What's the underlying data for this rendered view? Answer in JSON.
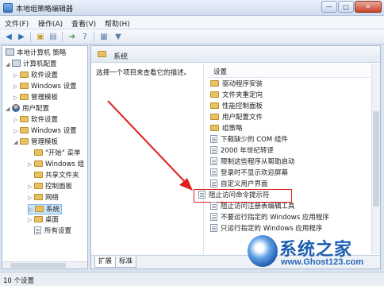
{
  "window": {
    "title": "本地组策略编辑器",
    "min": "—",
    "max": "□",
    "close": "✕"
  },
  "menu": [
    "文件(F)",
    "操作(A)",
    "查看(V)",
    "帮助(H)"
  ],
  "toolbar": {
    "icons": [
      "back-arrow-icon",
      "forward-arrow-icon",
      "up-folder-icon",
      "show-hide-tree-icon",
      "export-icon",
      "help-icon",
      "properties-icon",
      "filter-icon"
    ]
  },
  "tree": {
    "items": [
      {
        "label": "本地计算机 策略"
      },
      {
        "label": "计算机配置"
      },
      {
        "label": "软件设置"
      },
      {
        "label": "Windows 设置"
      },
      {
        "label": "管理模板"
      },
      {
        "label": "用户配置"
      },
      {
        "label": "软件设置"
      },
      {
        "label": "Windows 设置"
      },
      {
        "label": "管理模板"
      },
      {
        "label": "\"开始\" 菜单"
      },
      {
        "label": "Windows 组"
      },
      {
        "label": "共享文件夹"
      },
      {
        "label": "控制面板"
      },
      {
        "label": "网络"
      },
      {
        "label": "系统"
      },
      {
        "label": "桌面"
      },
      {
        "label": "所有设置"
      }
    ]
  },
  "right": {
    "header": "系统",
    "description": "选择一个项目来查看它的描述。",
    "list_header": "设置",
    "folders": [
      "驱动程序安装",
      "文件夹重定向",
      "性能控制面板",
      "用户配置文件",
      "组策略"
    ],
    "settings": [
      "下载缺少的 COM 组件",
      "2000 年世纪转译",
      "限制这些程序从帮助启动",
      "登录时不显示欢迎屏幕",
      "自定义用户界面",
      "阻止访问命令提示符",
      "阻止访问注册表编辑工具",
      "不要运行指定的 Windows 应用程序",
      "只运行指定的 Windows 应用程序"
    ],
    "highlighted": "阻止访问命令提示符",
    "tabs": [
      "扩展",
      "标准"
    ]
  },
  "status": "10 个设置",
  "watermark": {
    "text": "系统之家",
    "url": "www.Ghost123.com"
  },
  "colors": {
    "annotation": "#e02020",
    "accent": "#1d5fb0"
  }
}
